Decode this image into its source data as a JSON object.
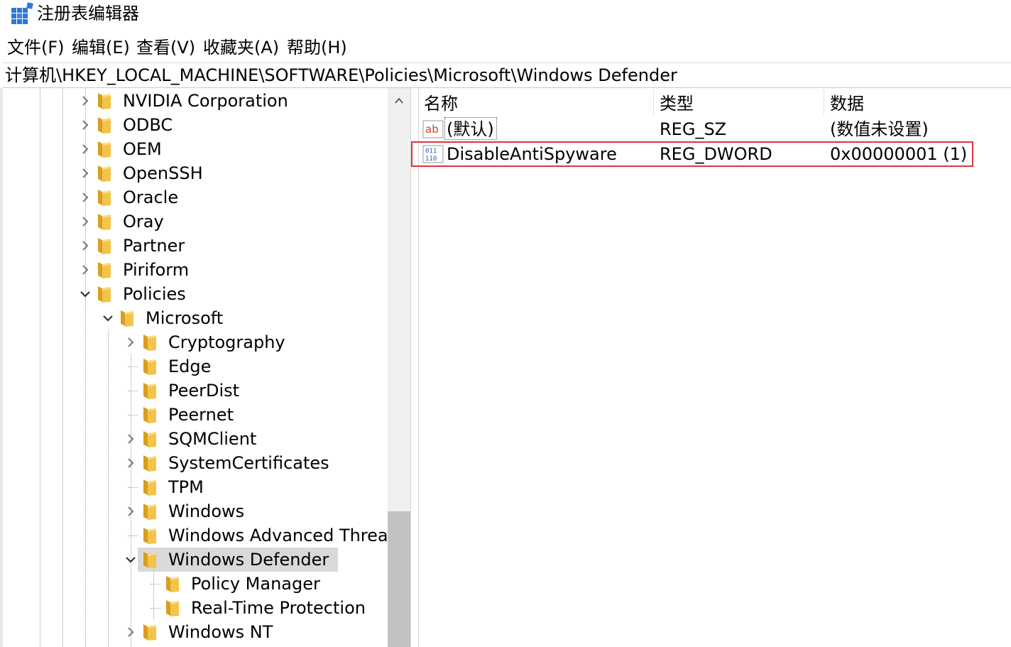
{
  "window": {
    "title": "注册表编辑器",
    "app_icon": "registry-editor-icon"
  },
  "menu": [
    "文件(F)",
    "编辑(E)",
    "查看(V)",
    "收藏夹(A)",
    "帮助(H)"
  ],
  "address": "计算机\\HKEY_LOCAL_MACHINE\\SOFTWARE\\Policies\\Microsoft\\Windows Defender",
  "tree": [
    {
      "label": "NVIDIA Corporation",
      "level": 0,
      "state": "collapsed"
    },
    {
      "label": "ODBC",
      "level": 0,
      "state": "collapsed"
    },
    {
      "label": "OEM",
      "level": 0,
      "state": "collapsed"
    },
    {
      "label": "OpenSSH",
      "level": 0,
      "state": "collapsed"
    },
    {
      "label": "Oracle",
      "level": 0,
      "state": "collapsed"
    },
    {
      "label": "Oray",
      "level": 0,
      "state": "collapsed"
    },
    {
      "label": "Partner",
      "level": 0,
      "state": "collapsed"
    },
    {
      "label": "Piriform",
      "level": 0,
      "state": "collapsed"
    },
    {
      "label": "Policies",
      "level": 0,
      "state": "expanded"
    },
    {
      "label": "Microsoft",
      "level": 1,
      "state": "expanded"
    },
    {
      "label": "Cryptography",
      "level": 2,
      "state": "collapsed"
    },
    {
      "label": "Edge",
      "level": 2,
      "state": "leaf"
    },
    {
      "label": "PeerDist",
      "level": 2,
      "state": "leaf"
    },
    {
      "label": "Peernet",
      "level": 2,
      "state": "leaf"
    },
    {
      "label": "SQMClient",
      "level": 2,
      "state": "collapsed"
    },
    {
      "label": "SystemCertificates",
      "level": 2,
      "state": "collapsed"
    },
    {
      "label": "TPM",
      "level": 2,
      "state": "leaf"
    },
    {
      "label": "Windows",
      "level": 2,
      "state": "collapsed"
    },
    {
      "label": "Windows Advanced Threat",
      "level": 2,
      "state": "leaf"
    },
    {
      "label": "Windows Defender",
      "level": 2,
      "state": "expanded",
      "selected": true
    },
    {
      "label": "Policy Manager",
      "level": 3,
      "state": "leaf"
    },
    {
      "label": "Real-Time Protection",
      "level": 3,
      "state": "leaf"
    },
    {
      "label": "Windows NT",
      "level": 2,
      "state": "collapsed"
    }
  ],
  "list": {
    "columns": {
      "name": "名称",
      "type": "类型",
      "data": "数据"
    },
    "rows": [
      {
        "icon": "string-value-icon",
        "name": "(默认)",
        "type": "REG_SZ",
        "data": "(数值未设置)"
      },
      {
        "icon": "dword-value-icon",
        "name": "DisableAntiSpyware",
        "type": "REG_DWORD",
        "data": "0x00000001 (1)",
        "highlighted": true
      }
    ]
  },
  "colors": {
    "highlight_box": "#e0333d",
    "selection": "#d9d9d9",
    "folder": "#f3c34a"
  }
}
